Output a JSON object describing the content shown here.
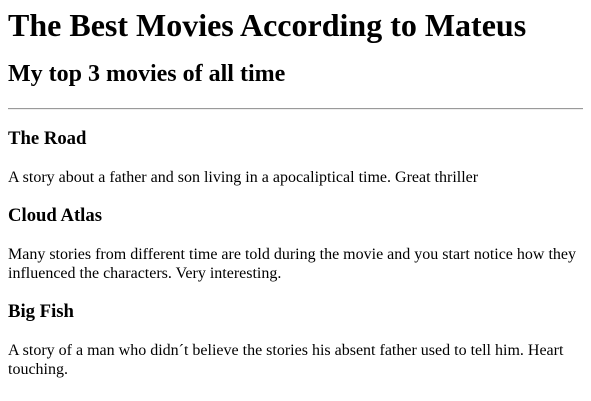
{
  "page": {
    "title": "The Best Movies According to Mateus",
    "subtitle": "My top 3 movies of all time"
  },
  "movies": [
    {
      "title": "The Road",
      "description": "A story about a father and son living in a apocaliptical time. Great thriller"
    },
    {
      "title": "Cloud Atlas",
      "description": "Many stories from different time are told during the movie and you start notice how they influenced the characters. Very interesting."
    },
    {
      "title": "Big Fish",
      "description": "A story of a man who didn´t believe the stories his absent father used to tell him. Heart touching."
    }
  ]
}
